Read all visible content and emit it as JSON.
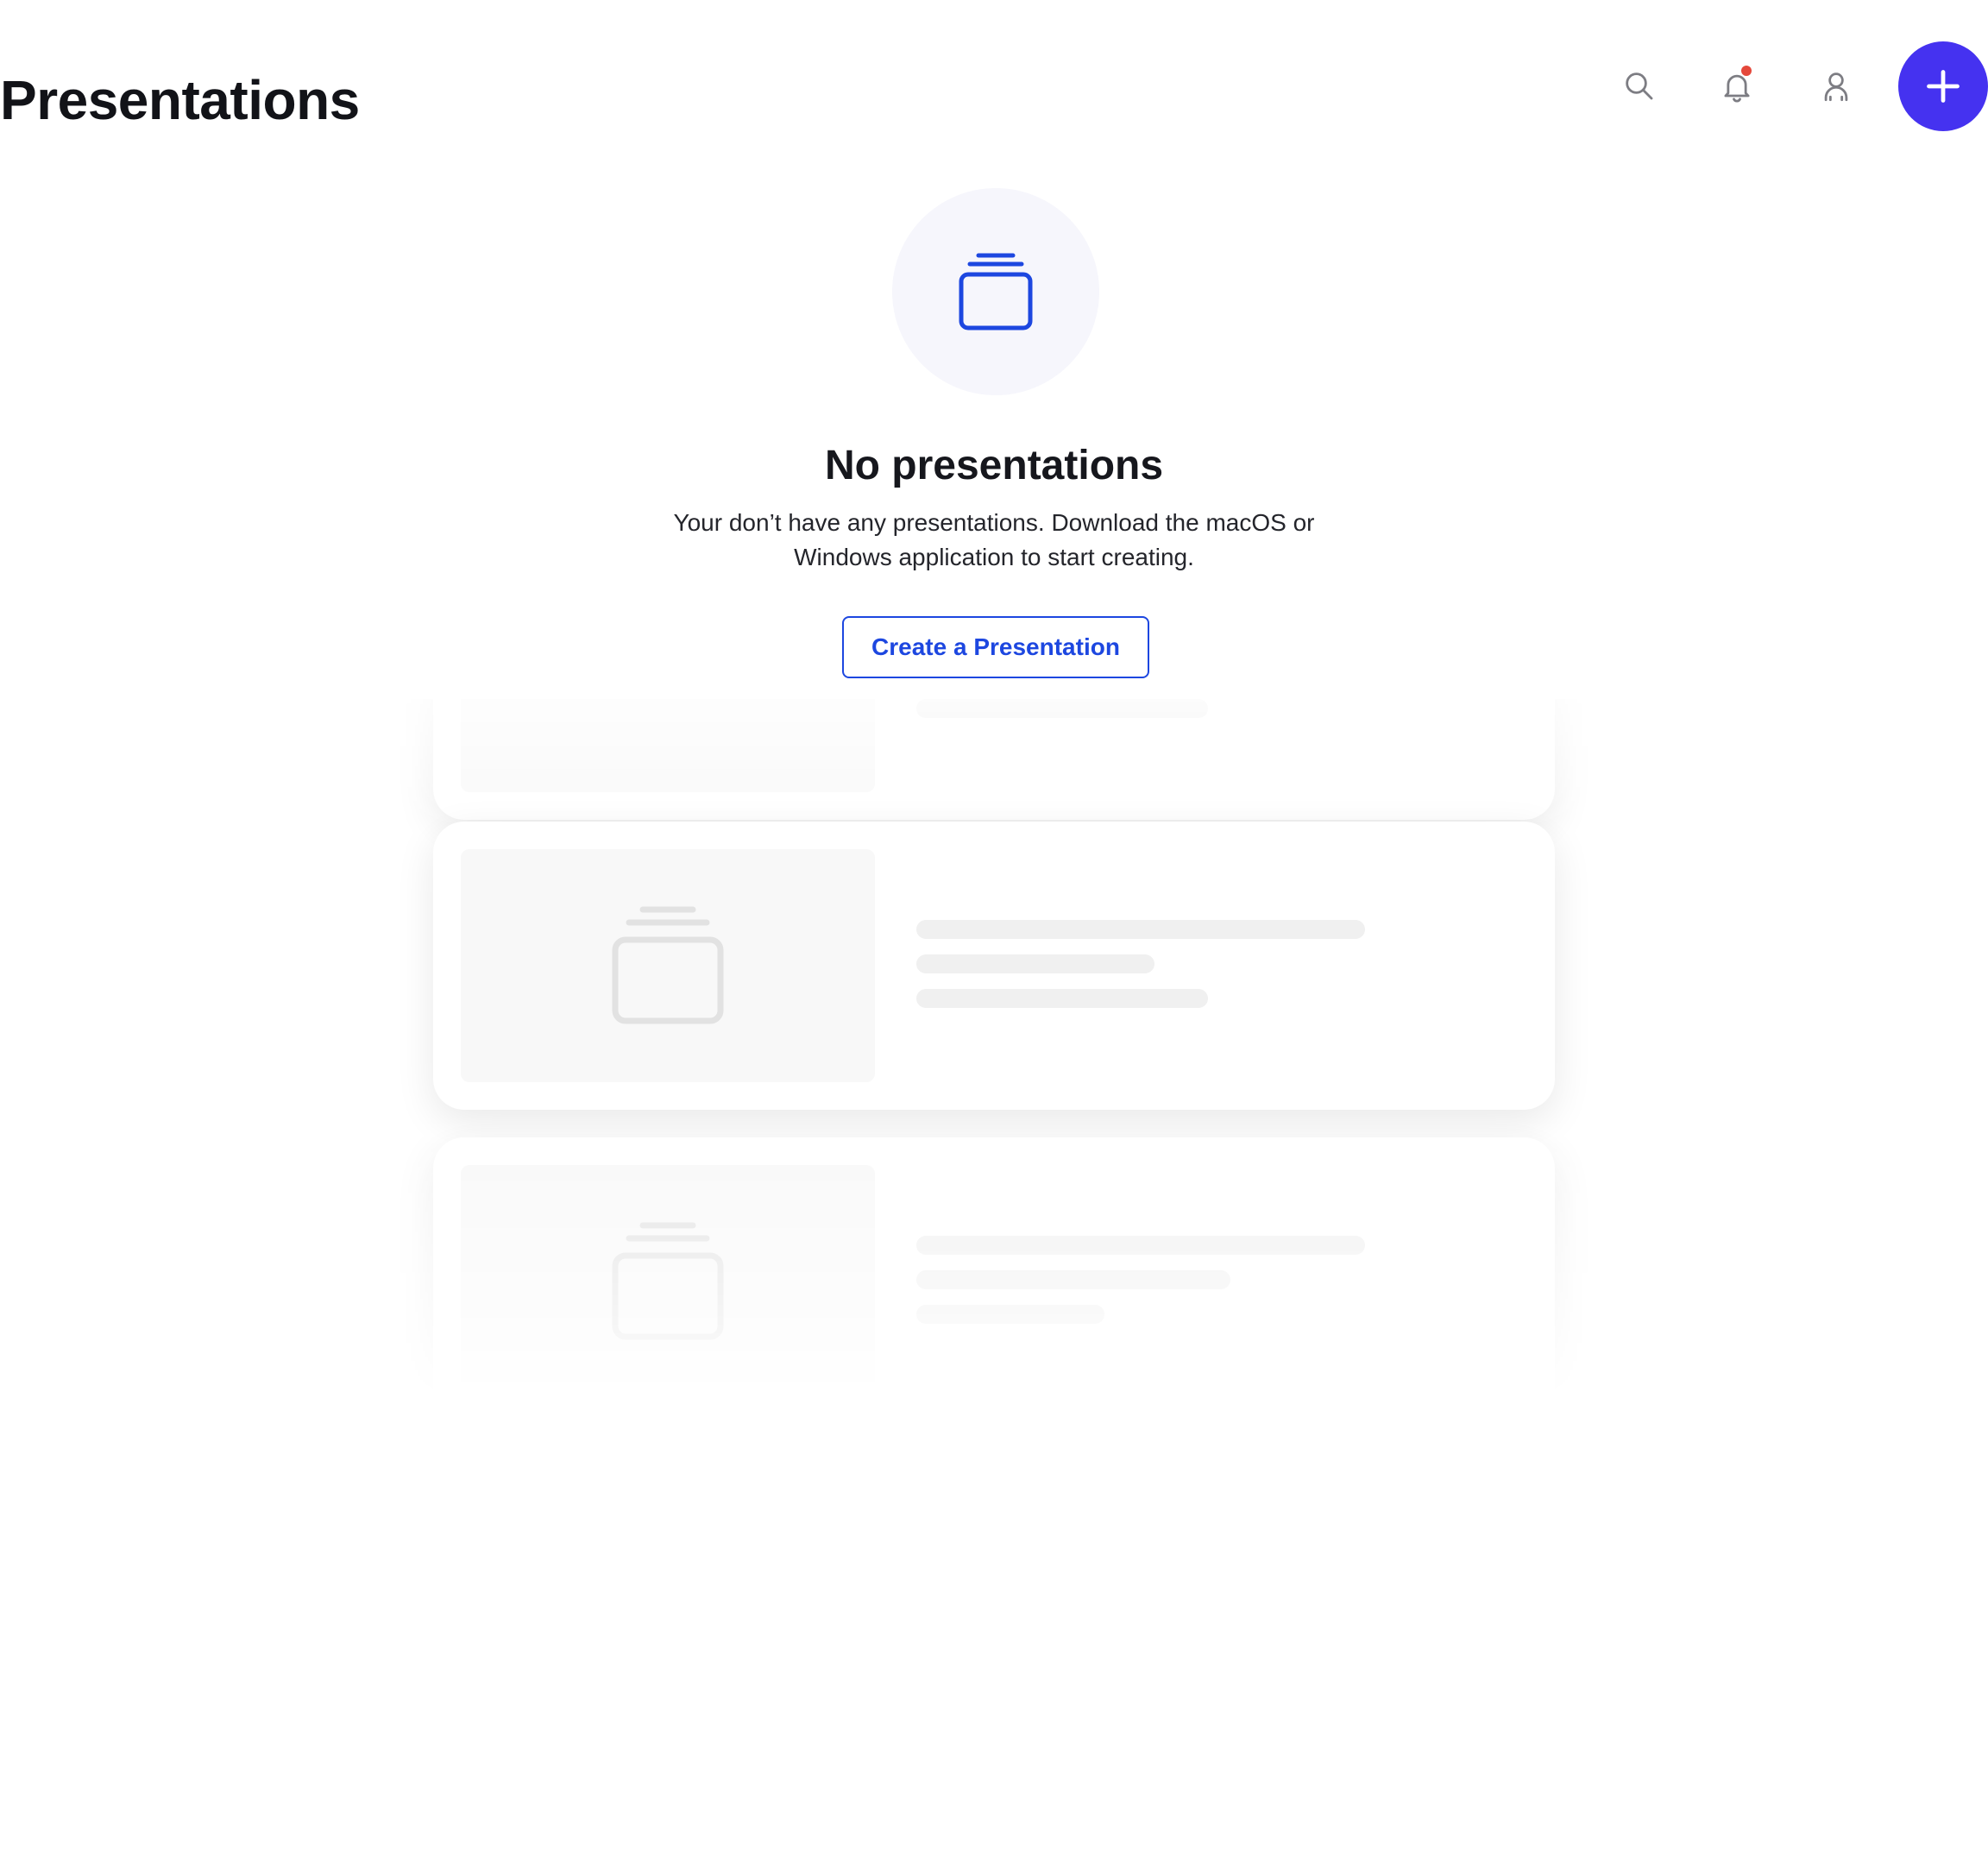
{
  "header": {
    "title": "Presentations",
    "icons": {
      "search": "search-icon",
      "notifications": "bell-icon",
      "account": "user-icon",
      "add": "plus-icon"
    },
    "has_unread_notification": true
  },
  "empty_state": {
    "icon": "presentation-stack-icon",
    "title": "No presentations",
    "description": "Your don’t have any presentations. Download the macOS or Windows application to start creating.",
    "button_label": "Create a Presentation"
  },
  "colors": {
    "accent": "#4532f0",
    "link_blue": "#1d47e0",
    "notification_dot": "#e5483b",
    "skeleton": "#f0f0f0"
  }
}
